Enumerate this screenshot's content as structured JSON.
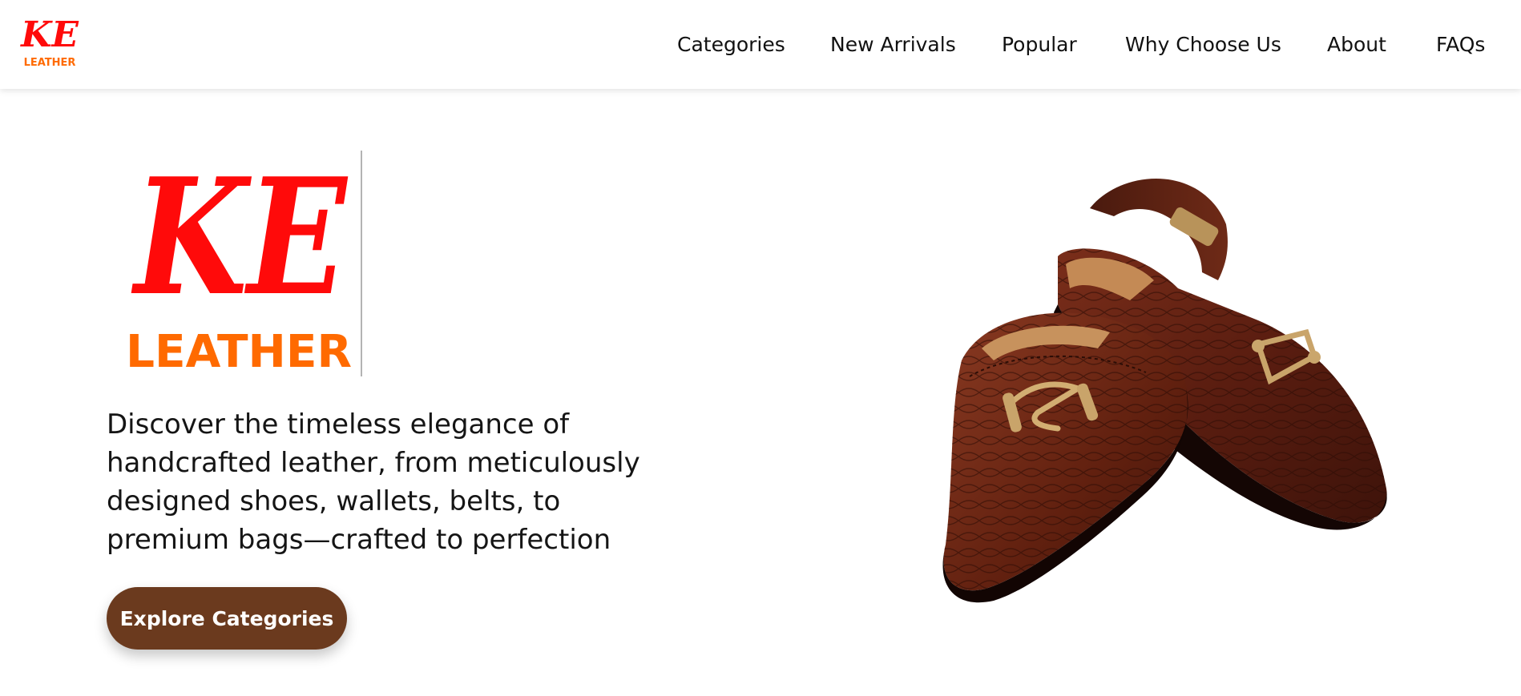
{
  "brand": {
    "logo_mark": "KE",
    "logo_word": "LEATHER",
    "mark_color": "#ff0a0a",
    "word_color": "#ff6a00"
  },
  "nav": {
    "items": [
      {
        "label": "Categories"
      },
      {
        "label": "New Arrivals"
      },
      {
        "label": "Popular"
      },
      {
        "label": "Why Choose Us"
      },
      {
        "label": "About"
      },
      {
        "label": "FAQs"
      }
    ]
  },
  "hero": {
    "tagline": "Discover the timeless elegance of handcrafted leather, from meticulously designed shoes, wallets, belts, to premium bags—crafted to perfection",
    "cta_label": "Explore Categories",
    "cta_color": "#6b3a1e",
    "image_icon": "leather-shoes-image"
  }
}
